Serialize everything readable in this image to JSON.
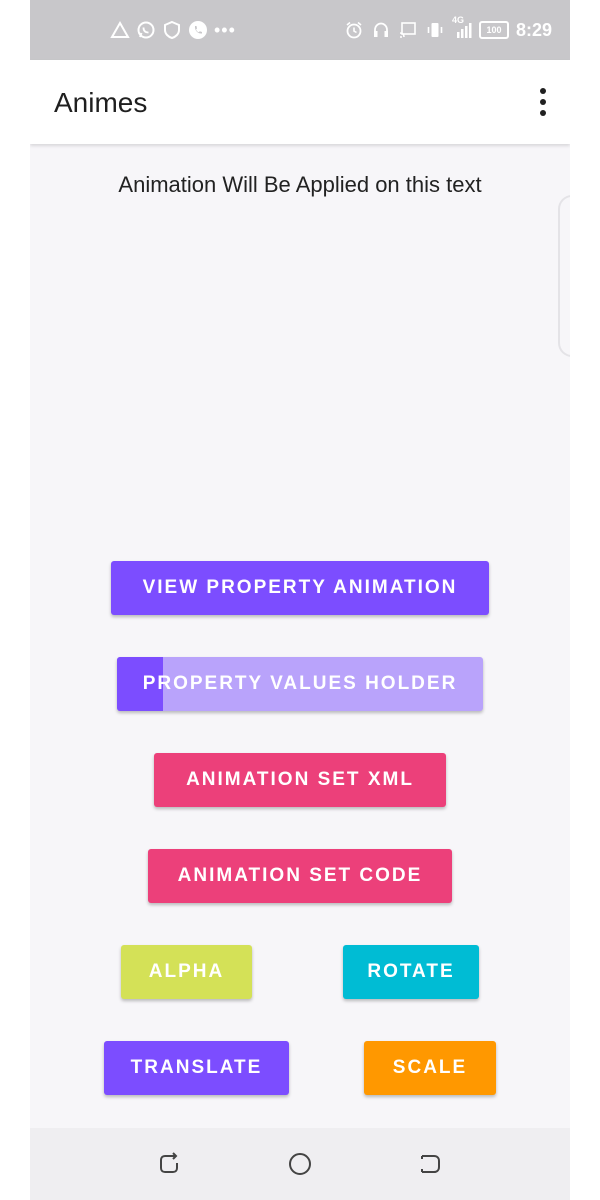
{
  "status_bar": {
    "time": "8:29",
    "battery": "100",
    "network_label": "4G",
    "left_icons": [
      "signal-triangle-icon",
      "whatsapp-icon",
      "shield-icon",
      "phone-call-icon"
    ],
    "overflow_dots": "•••",
    "right_icons": [
      "alarm-icon",
      "headset-icon",
      "cast-icon",
      "vibrate-icon",
      "cell-signal-icon",
      "battery-icon"
    ]
  },
  "app_bar": {
    "title": "Animes",
    "menu_icon": "more-vert-icon"
  },
  "main": {
    "animated_text": "Animation Will Be Applied on this text"
  },
  "buttons": {
    "view_property_animation": "VIEW PROPERTY ANIMATION",
    "property_values_holder": "PROPERTY VALUES HOLDER",
    "animation_set_xml": "ANIMATION SET XML",
    "animation_set_code": "ANIMATION SET CODE",
    "alpha": "ALPHA",
    "rotate": "ROTATE",
    "translate": "TRANSLATE",
    "scale": "SCALE"
  },
  "colors": {
    "purple": "#7c4dff",
    "purple_light": "#b9a3fb",
    "pink": "#ec407a",
    "lime": "#d4e157",
    "cyan": "#00bcd4",
    "orange": "#ff9800",
    "status_bar": "#c8c7ca",
    "background": "#f7f6f9"
  },
  "nav_bar": {
    "icons": [
      "back-icon",
      "home-icon",
      "recents-icon"
    ]
  }
}
